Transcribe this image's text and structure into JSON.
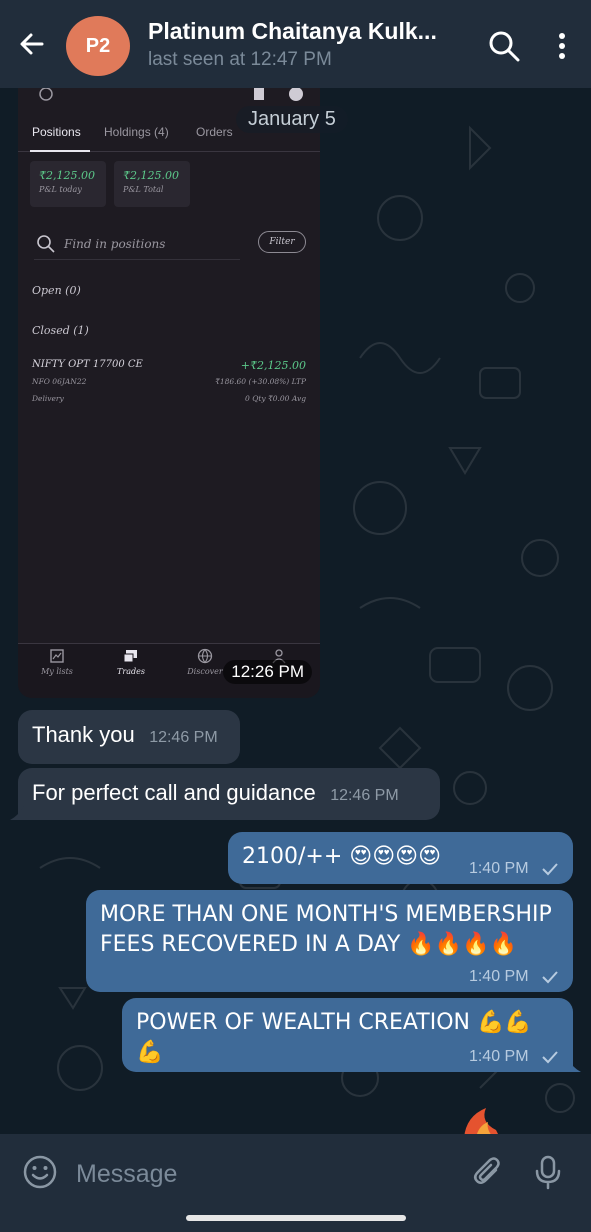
{
  "header": {
    "avatar_initials": "P2",
    "avatar_color": "#e07a5a",
    "title": "Platinum Chaitanya Kulk...",
    "status": "last seen at 12:47 PM",
    "icons": [
      "back-arrow-icon",
      "search-icon",
      "more-vertical-icon"
    ]
  },
  "date_label": "January 5",
  "photo_message": {
    "time": "12:26 PM",
    "screenshot": {
      "tabs": [
        "Positions",
        "Holdings (4)",
        "Orders"
      ],
      "pl_today": {
        "value": "₹2,125.00",
        "label": "P&L today"
      },
      "pl_total": {
        "value": "₹2,125.00",
        "label": "P&L Total"
      },
      "find_placeholder": "Find in positions",
      "filter_label": "Filter",
      "open_label": "Open (0)",
      "closed_label": "Closed (1)",
      "position": {
        "name": "NIFTY OPT 17700 CE",
        "pnl": "+₹2,125.00",
        "exchange": "NFO 06JAN22",
        "ltp": "₹186.60 (+30.08%) LTP",
        "type": "Delivery",
        "qty": "0 Qty  ₹0.00 Avg"
      },
      "nav": [
        "My lists",
        "Trades",
        "Discover"
      ]
    }
  },
  "messages": [
    {
      "direction": "in",
      "text": "Thank you",
      "time": "12:46 PM"
    },
    {
      "direction": "in",
      "text": "For perfect call and guidance",
      "time": "12:46 PM"
    },
    {
      "direction": "out",
      "text": "2100/++ 😍😍😍😍",
      "time": "1:40 PM"
    },
    {
      "direction": "out",
      "text": "MORE THAN ONE MONTH'S MEMBERSHIP FEES RECOVERED IN A DAY 🔥🔥🔥🔥",
      "time": "1:40 PM"
    },
    {
      "direction": "out",
      "text": "POWER OF WEALTH CREATION 💪💪💪",
      "time": "1:40 PM"
    }
  ],
  "composer": {
    "placeholder": "Message",
    "icons": [
      "emoji-icon",
      "attach-icon",
      "mic-icon"
    ]
  },
  "colors": {
    "header_bg": "#212d3b",
    "chat_bg": "#101c26",
    "incoming_bubble": "#2b3644",
    "outgoing_bubble": "#3f6a98",
    "pnl_green": "#5cc98a"
  }
}
